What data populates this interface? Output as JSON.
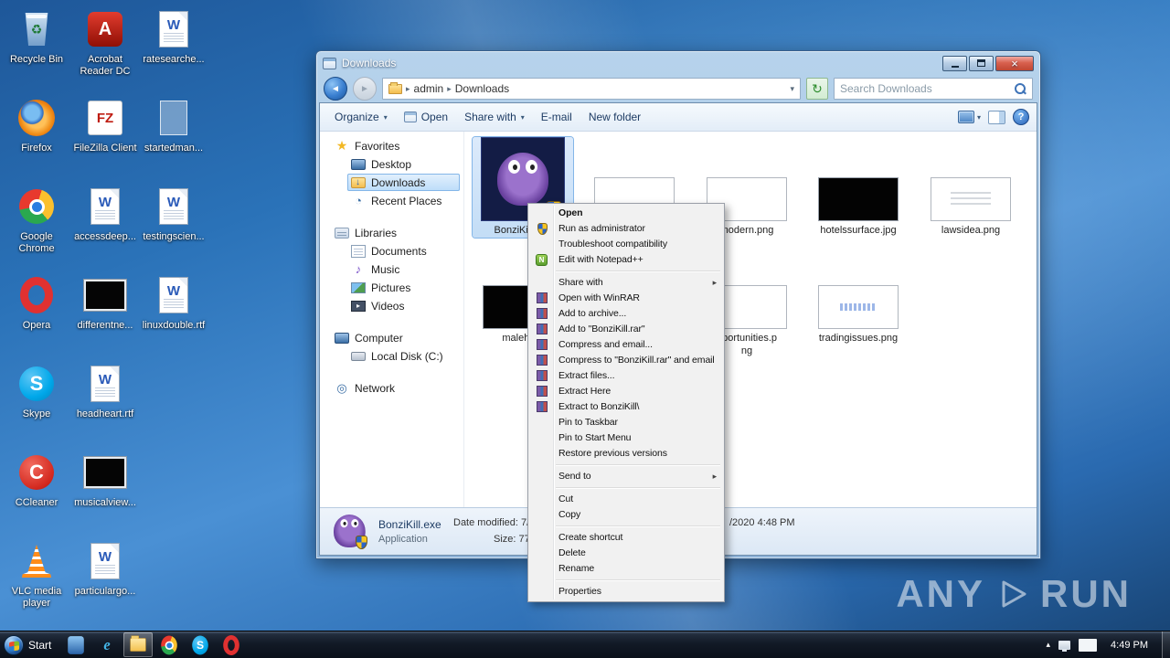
{
  "desktop": {
    "columns": [
      [
        {
          "label": "Recycle Bin",
          "icon": "recycle-bin-icon"
        },
        {
          "label": "Firefox",
          "icon": "firefox-icon"
        },
        {
          "label": "Google Chrome",
          "icon": "chrome-icon"
        },
        {
          "label": "Opera",
          "icon": "opera-icon"
        },
        {
          "label": "Skype",
          "icon": "skype-icon"
        },
        {
          "label": "CCleaner",
          "icon": "ccleaner-icon"
        },
        {
          "label": "VLC media player",
          "icon": "vlc-icon"
        }
      ],
      [
        {
          "label": "Acrobat Reader DC",
          "icon": "acrobat-icon"
        },
        {
          "label": "FileZilla Client",
          "icon": "filezilla-icon"
        },
        {
          "label": "accessdeep...",
          "icon": "word-doc-icon"
        },
        {
          "label": "differentne...",
          "icon": "image-black-icon"
        },
        {
          "label": "headheart.rtf",
          "icon": "word-doc-icon"
        },
        {
          "label": "musicalview...",
          "icon": "image-black-icon"
        },
        {
          "label": "particulargo...",
          "icon": "word-doc-icon"
        }
      ],
      [
        {
          "label": "ratesearche...",
          "icon": "word-doc-icon"
        },
        {
          "label": "startedman...",
          "icon": "ghost-doc-icon"
        },
        {
          "label": "testingscien...",
          "icon": "word-doc-icon"
        },
        {
          "label": "linuxdouble.rtf",
          "icon": "word-doc-icon"
        }
      ]
    ]
  },
  "window": {
    "title": "Downloads",
    "address": {
      "location_user": "admin",
      "location_folder": "Downloads",
      "search_placeholder": "Search Downloads"
    },
    "toolbar": {
      "items": [
        {
          "label": "Organize",
          "dropdown": true
        },
        {
          "label": "Open",
          "icon": "open-app-icon"
        },
        {
          "label": "Share with",
          "dropdown": true
        },
        {
          "label": "E-mail"
        },
        {
          "label": "New folder"
        }
      ]
    },
    "sidebar": {
      "items": [
        {
          "label": "Favorites",
          "icon": "favorites-star-icon",
          "depth": "root"
        },
        {
          "label": "Desktop",
          "icon": "desktop-item-icon",
          "depth": "child"
        },
        {
          "label": "Downloads",
          "icon": "downloads-folder-icon",
          "depth": "child",
          "state": "selected"
        },
        {
          "label": "Recent Places",
          "icon": "recent-places-icon",
          "depth": "child"
        },
        {
          "label": "Libraries",
          "icon": "libraries-icon",
          "depth": "root",
          "group_start": true
        },
        {
          "label": "Documents",
          "icon": "documents-icon",
          "depth": "child"
        },
        {
          "label": "Music",
          "icon": "music-icon",
          "depth": "child"
        },
        {
          "label": "Pictures",
          "icon": "pictures-icon",
          "depth": "child"
        },
        {
          "label": "Videos",
          "icon": "videos-icon",
          "depth": "child"
        },
        {
          "label": "Computer",
          "icon": "computer-icon",
          "depth": "root",
          "group_start": true
        },
        {
          "label": "Local Disk (C:)",
          "icon": "local-disk-icon",
          "depth": "child"
        },
        {
          "label": "Network",
          "icon": "network-icon",
          "depth": "root",
          "group_start": true
        }
      ]
    },
    "files": [
      {
        "label": "BonziKill.exe",
        "thumb": "bonzi",
        "row": "r0",
        "col": "c0",
        "state": "selected",
        "shield": true
      },
      {
        "label": "",
        "thumb": "imgwhite",
        "row": "r0",
        "col": "c1"
      },
      {
        "label": "modern.png",
        "thumb": "imgwhite",
        "row": "r0",
        "col": "c2"
      },
      {
        "label": "hotelssurface.jpg",
        "thumb": "imgblack",
        "row": "r0",
        "col": "c3"
      },
      {
        "label": "lawsidea.png",
        "thumb": "imgsketch",
        "row": "r0",
        "col": "c4"
      },
      {
        "label": "maleho...",
        "thumb": "imgblack",
        "row": "r1",
        "col": "c0"
      },
      {
        "label": "pportunities.p\nng",
        "thumb": "imgwhite",
        "row": "r1",
        "col": "c2"
      },
      {
        "label": "tradingissues.png",
        "thumb": "imgtext",
        "row": "r1",
        "col": "c3"
      }
    ],
    "details": {
      "file_name": "BonziKill.exe",
      "file_type": "Application",
      "date_label_fragment": "Date modified: 7/",
      "date_value_fragment": "/2020 4:48 PM",
      "size_fragment": "Size: 77"
    }
  },
  "context_menu": {
    "items": [
      {
        "label": "Open",
        "bold": true
      },
      {
        "label": "Run as administrator",
        "icon": "uac-shield-icon"
      },
      {
        "label": "Troubleshoot compatibility"
      },
      {
        "label": "Edit with Notepad++",
        "icon": "notepadpp-icon"
      },
      {
        "type": "separator"
      },
      {
        "label": "Share with",
        "submenu": true
      },
      {
        "label": "Open with WinRAR",
        "icon": "winrar-icon"
      },
      {
        "label": "Add to archive...",
        "icon": "winrar-icon"
      },
      {
        "label": "Add to \"BonziKill.rar\"",
        "icon": "winrar-icon"
      },
      {
        "label": "Compress and email...",
        "icon": "winrar-icon"
      },
      {
        "label": "Compress to \"BonziKill.rar\" and email",
        "icon": "winrar-icon"
      },
      {
        "label": "Extract files...",
        "icon": "winrar-icon"
      },
      {
        "label": "Extract Here",
        "icon": "winrar-icon"
      },
      {
        "label": "Extract to BonziKill\\",
        "icon": "winrar-icon"
      },
      {
        "label": "Pin to Taskbar"
      },
      {
        "label": "Pin to Start Menu"
      },
      {
        "label": "Restore previous versions"
      },
      {
        "type": "separator"
      },
      {
        "label": "Send to",
        "submenu": true
      },
      {
        "type": "separator"
      },
      {
        "label": "Cut"
      },
      {
        "label": "Copy"
      },
      {
        "type": "separator"
      },
      {
        "label": "Create shortcut"
      },
      {
        "label": "Delete"
      },
      {
        "label": "Rename"
      },
      {
        "type": "separator"
      },
      {
        "label": "Properties"
      }
    ]
  },
  "taskbar": {
    "start_label": "Start",
    "items": [
      {
        "icon": "app-blue-icon"
      },
      {
        "icon": "internet-explorer-icon"
      },
      {
        "icon": "explorer-folder-icon",
        "state": "active"
      },
      {
        "icon": "chrome-icon"
      },
      {
        "icon": "skype-icon"
      },
      {
        "icon": "opera-icon"
      }
    ],
    "tray": {
      "clock": "4:49 PM"
    }
  },
  "watermark": {
    "left": "ANY",
    "right": "RUN"
  },
  "icons": {
    "close_glyph": "×",
    "back_glyph": "◄",
    "forward_glyph": "►",
    "breadcrumb_chevron_glyph": "▸",
    "dropdown_glyph": "▾",
    "refresh_glyph": "↻",
    "help_glyph": "?",
    "tray_expand_glyph": "▴"
  }
}
